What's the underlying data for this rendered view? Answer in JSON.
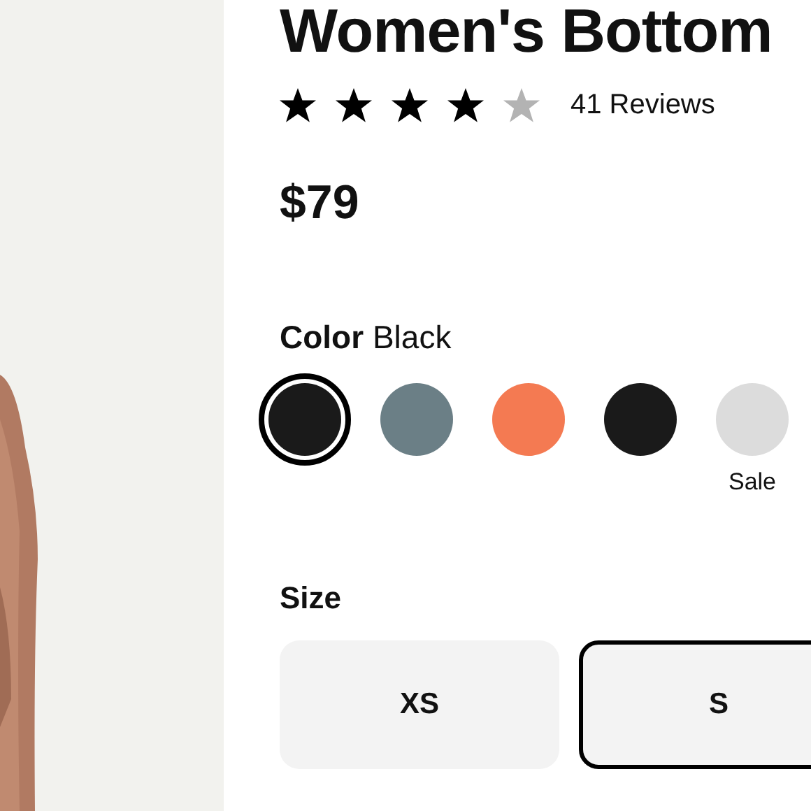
{
  "product": {
    "title": "Women's Bottom",
    "stars": 4,
    "reviews": "41 Reviews",
    "price": "$79"
  },
  "color": {
    "label": "Color",
    "value": "Black",
    "swatches": [
      {
        "color": "#1a1a1a",
        "selected": true
      },
      {
        "color": "#6b7f86",
        "selected": false
      },
      {
        "color": "#f47a52",
        "selected": false
      },
      {
        "color": "#1a1a1a",
        "selected": false
      },
      {
        "color": "#dcdcdc",
        "selected": false,
        "note": "Sale"
      }
    ]
  },
  "size": {
    "label": "Size",
    "options": [
      {
        "label": "XS",
        "selected": false
      },
      {
        "label": "S",
        "selected": true
      }
    ]
  }
}
